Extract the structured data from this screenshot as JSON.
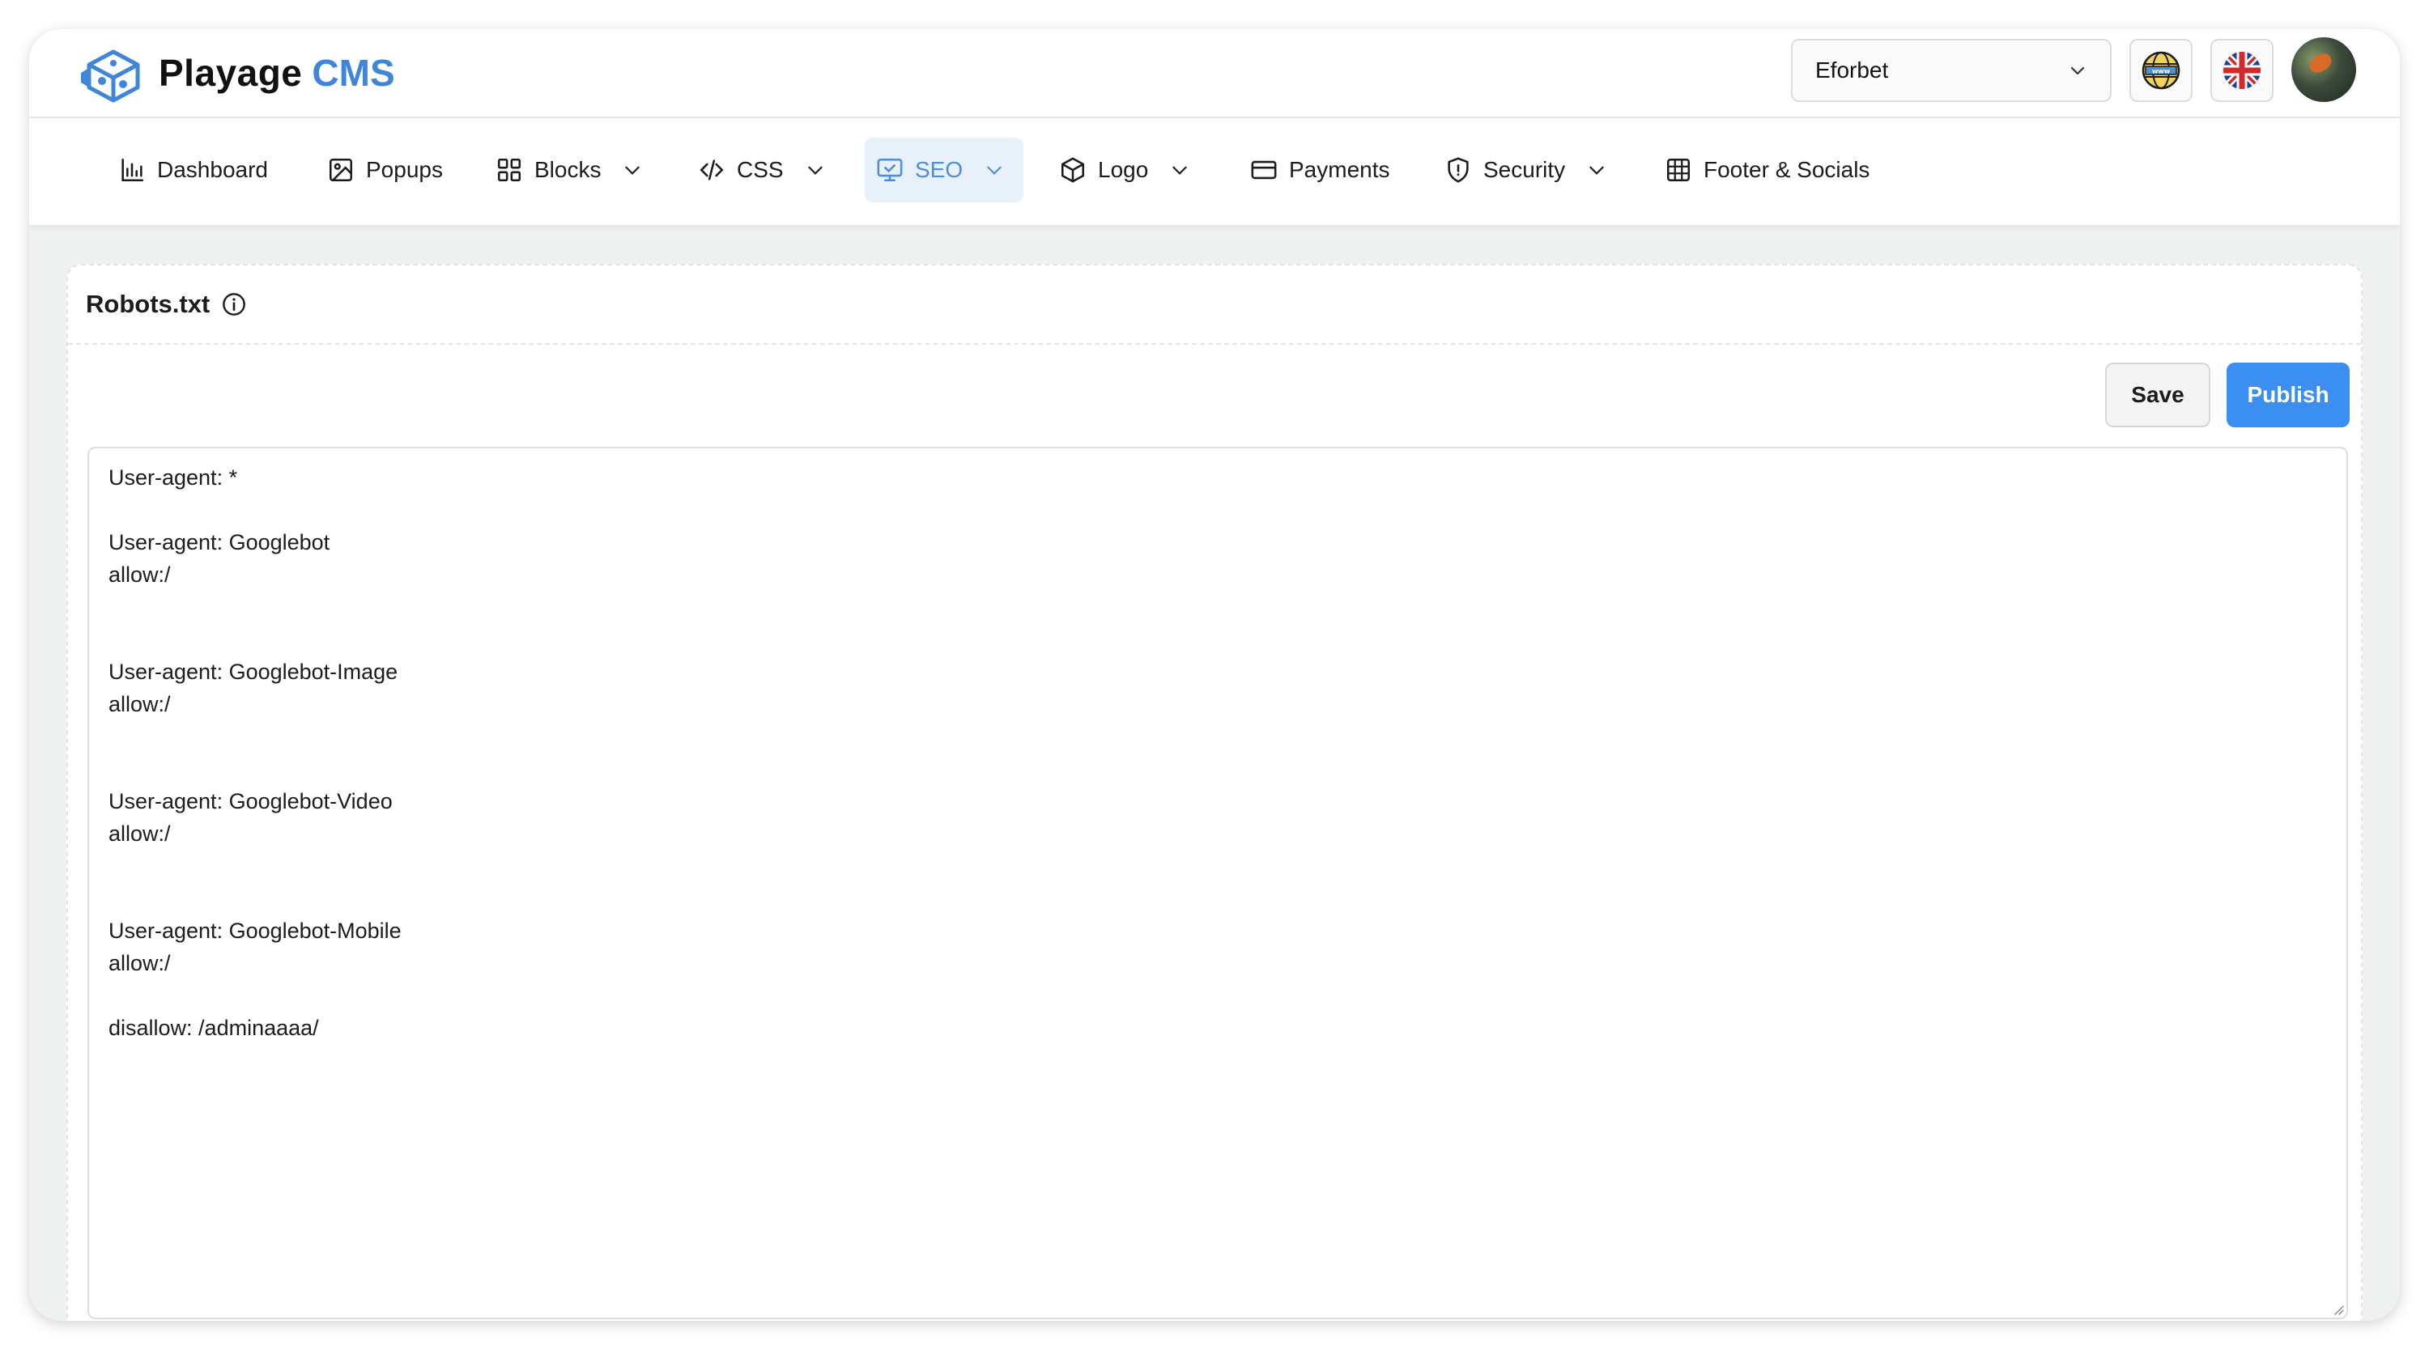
{
  "brand": {
    "name": "Playage",
    "accent": "CMS",
    "accent_color": "#3f86d8"
  },
  "header": {
    "site_selector": {
      "value": "Eforbet"
    },
    "buttons": [
      {
        "name": "website-globe",
        "icon": "globe-www-icon"
      },
      {
        "name": "language",
        "icon": "uk-flag-icon"
      }
    ],
    "avatar": "user-avatar"
  },
  "nav": [
    {
      "label": "Dashboard",
      "icon": "bar-chart-icon",
      "dropdown": false
    },
    {
      "label": "Popups",
      "icon": "image-icon",
      "dropdown": false
    },
    {
      "label": "Blocks",
      "icon": "grid-icon",
      "dropdown": true
    },
    {
      "label": "CSS",
      "icon": "code-icon",
      "dropdown": true
    },
    {
      "label": "SEO",
      "icon": "monitor-check-icon",
      "dropdown": true,
      "active": true
    },
    {
      "label": "Logo",
      "icon": "box-icon",
      "dropdown": true
    },
    {
      "label": "Payments",
      "icon": "credit-card-icon",
      "dropdown": false
    },
    {
      "label": "Security",
      "icon": "shield-icon",
      "dropdown": true
    },
    {
      "label": "Footer & Socials",
      "icon": "layout-grid-icon",
      "dropdown": false
    }
  ],
  "panel": {
    "title": "Robots.txt",
    "save_label": "Save",
    "publish_label": "Publish",
    "editor_content": "User-agent: *\n\nUser-agent: Googlebot\nallow:/\n\n\nUser-agent: Googlebot-Image\nallow:/\n\n\nUser-agent: Googlebot-Video\nallow:/\n\n\nUser-agent: Googlebot-Mobile\nallow:/\n\ndisallow: /adminaaaa/"
  },
  "colors": {
    "primary": "#3b8ff0",
    "active_nav_bg": "#e8f0fa",
    "active_nav_text": "#4a8fd9",
    "page_bg": "#eff1f0"
  }
}
